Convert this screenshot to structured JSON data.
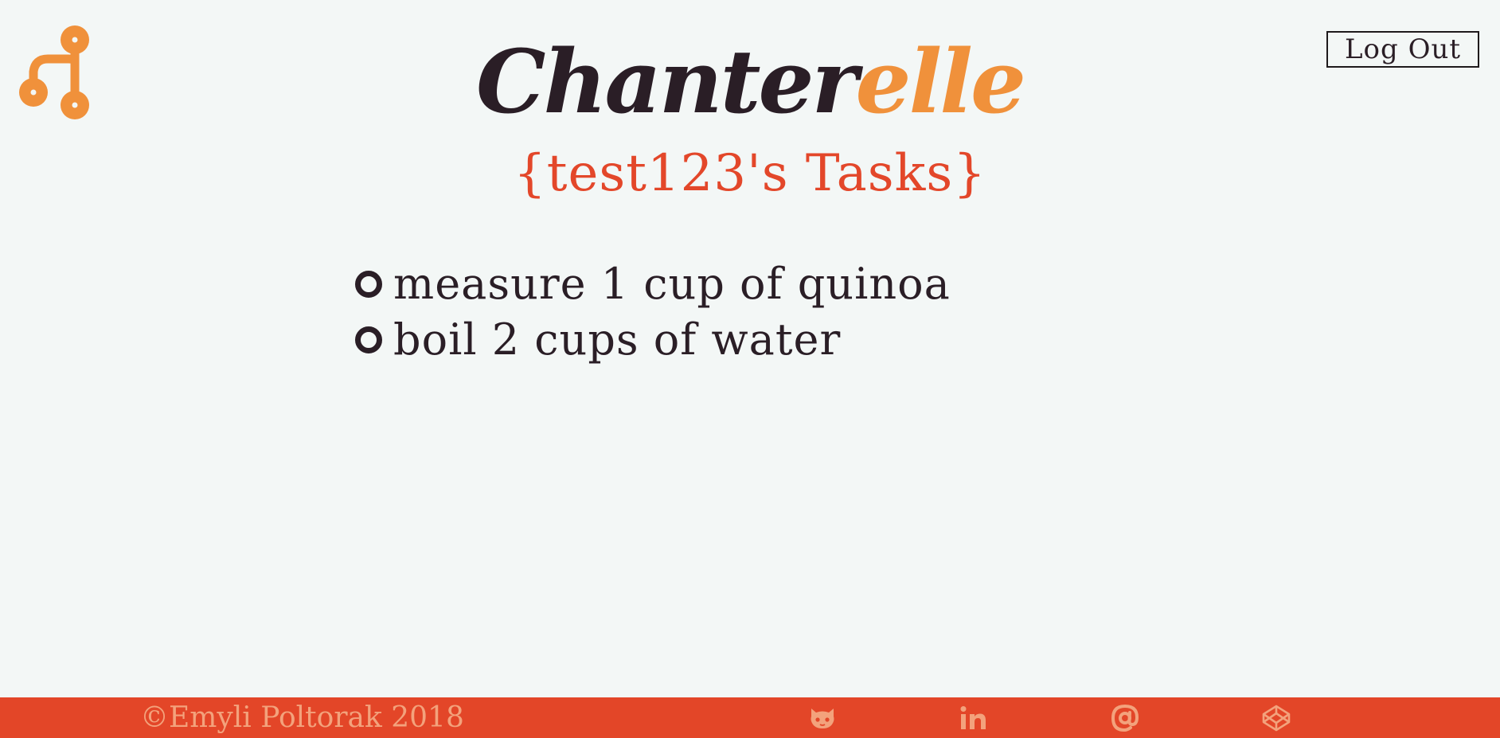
{
  "header": {
    "brand_part1": "Chanter",
    "brand_part2": "elle",
    "logout_label": "Log Out"
  },
  "page": {
    "subtitle": "{test123's Tasks}"
  },
  "tasks": [
    {
      "text": "measure 1 cup of quinoa",
      "done": false
    },
    {
      "text": "boil 2 cups of water",
      "done": false
    }
  ],
  "footer": {
    "copyright": "©Emyli Poltorak 2018",
    "social_icons": [
      "github-icon",
      "linkedin-icon",
      "email-icon",
      "codepen-icon"
    ]
  },
  "colors": {
    "background": "#f3f7f6",
    "brand_dark": "#2a1e26",
    "brand_orange": "#f0913b",
    "accent_red": "#e3472a",
    "footer_bg": "#e34628",
    "footer_text": "#f3a27c"
  }
}
